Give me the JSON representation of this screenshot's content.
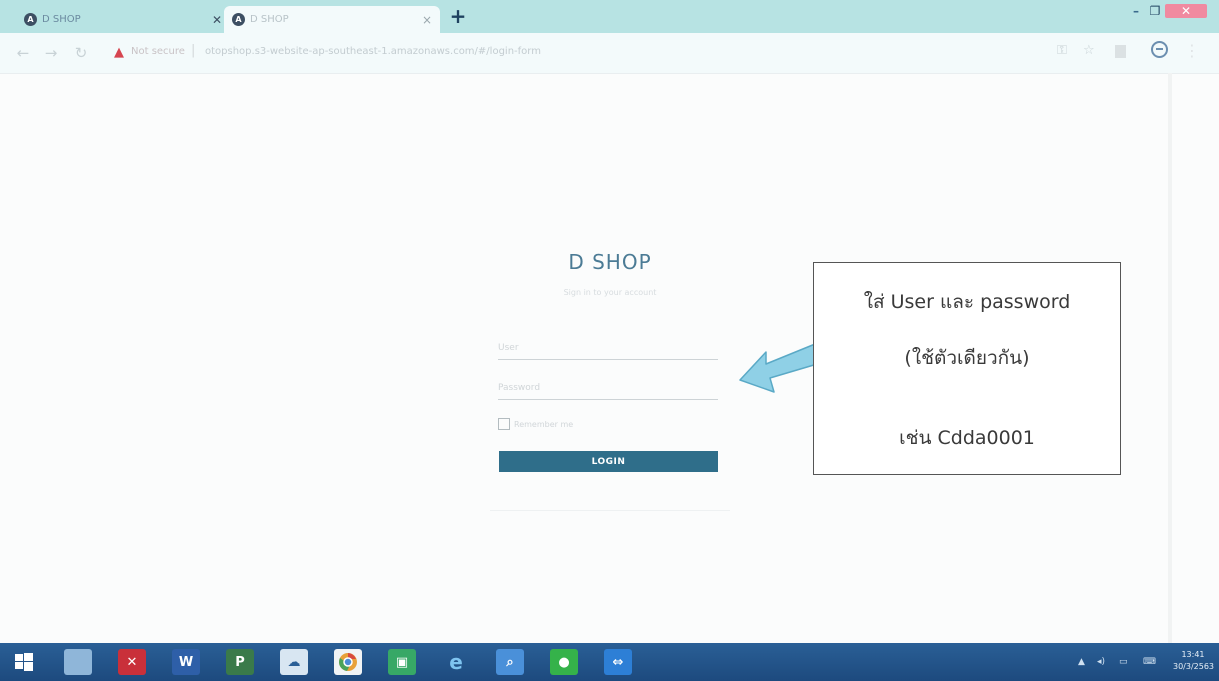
{
  "browser": {
    "tabs": [
      {
        "title": "D SHOP",
        "favicon": "angular-favicon"
      },
      {
        "title": "D SHOP",
        "favicon": "angular-favicon"
      }
    ],
    "new_tab": "+",
    "url_warning": "Not secure",
    "url": "otopshop.s3-website-ap-southeast-1.amazonaws.com/#/login-form"
  },
  "login": {
    "brand": "D SHOP",
    "subtitle": "Sign in to your account",
    "username_placeholder": "User",
    "password_placeholder": "Password",
    "remember_label": "Remember me",
    "login_button": "LOGIN"
  },
  "annotation": {
    "line1": "ใส่ User และ password",
    "line2": "(ใช้ตัวเดียวกัน)",
    "line3": "เช่น Cdda0001",
    "arrow_color": "#8fd0e6"
  },
  "taskbar": {
    "apps": [
      "start-icon",
      "file-explorer-icon",
      "acrobat-icon",
      "word-icon",
      "project-icon",
      "onedrive-icon",
      "chrome-icon",
      "store-icon",
      "ie-icon",
      "search-app-icon",
      "line-icon",
      "teamviewer-icon"
    ],
    "clock_time": "13:41",
    "clock_date": "30/3/2563"
  },
  "colors": {
    "accent": "#2f6e8a",
    "brand_text": "#4b7b95",
    "tab_strip": "#b7e3e3",
    "taskbar": "#1d4a7e"
  }
}
